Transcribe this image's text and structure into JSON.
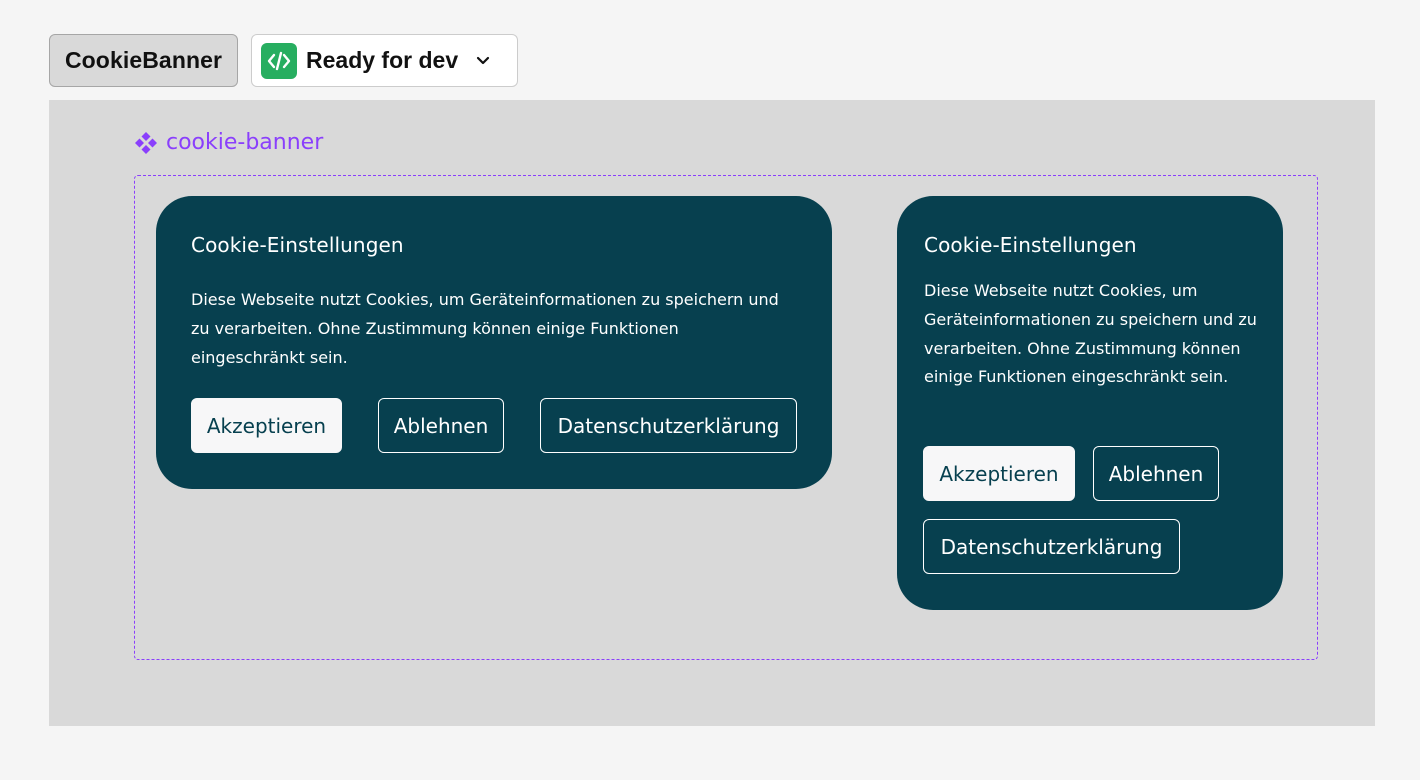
{
  "toolbar": {
    "component_name": "CookieBanner",
    "status_label": "Ready for dev",
    "status_icon": "code-icon",
    "status_color": "#27ae60"
  },
  "canvas": {
    "component_label": "cookie-banner",
    "accent_color": "#8a3ffc",
    "banner_color": "#07404f"
  },
  "banners": [
    {
      "title": "Cookie-Einstellungen",
      "text": "Diese Webseite nutzt Cookies, um Geräteinformationen zu speichern und zu verarbeiten. Ohne Zustimmung können einige Funktionen eingeschränkt sein.",
      "accept_label": "Akzeptieren",
      "reject_label": "Ablehnen",
      "privacy_label": "Datenschutzerklärung"
    },
    {
      "title": "Cookie-Einstellungen",
      "text": "Diese Webseite nutzt Cookies, um Geräteinformationen zu speichern und zu verarbeiten. Ohne Zustimmung können einige Funktionen eingeschränkt sein.",
      "accept_label": "Akzeptieren",
      "reject_label": "Ablehnen",
      "privacy_label": "Datenschutzerklärung"
    }
  ]
}
